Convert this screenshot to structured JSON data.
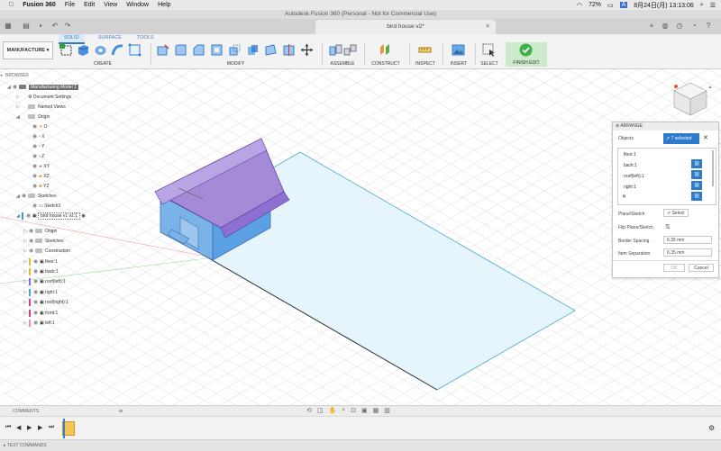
{
  "macbar": {
    "app": "Fusion 360",
    "menus": [
      "File",
      "Edit",
      "View",
      "Window",
      "Help"
    ],
    "battery": "72%",
    "datetime": "8月24日(月)  13:13:06"
  },
  "window": {
    "title": "Autodesk Fusion 360 (Personal - Not for Commercial Use)"
  },
  "document_tab": {
    "title": "bird house v2*"
  },
  "toolbar": {
    "workspace": "MANUFACTURE",
    "tabs": [
      "SOLID",
      "SURFACE",
      "TOOLS"
    ],
    "active_tab": "SOLID",
    "groups": [
      "CREATE",
      "MODIFY",
      "ASSEMBLE",
      "CONSTRUCT",
      "INSPECT",
      "INSERT",
      "SELECT",
      "FINISH EDIT"
    ]
  },
  "browser": {
    "header": "BROWSER",
    "rows": [
      {
        "label": "Manufacturing Model 1"
      },
      {
        "label": "Document Settings"
      },
      {
        "label": "Named Views"
      },
      {
        "label": "Origin"
      },
      {
        "label": "O"
      },
      {
        "label": "X"
      },
      {
        "label": "Y"
      },
      {
        "label": "Z"
      },
      {
        "label": "XY"
      },
      {
        "label": "XZ"
      },
      {
        "label": "YZ"
      },
      {
        "label": "Sketches"
      },
      {
        "label": "Sketch3"
      },
      {
        "label": "bird house v1 v2:1"
      },
      {
        "label": "Origin"
      },
      {
        "label": "Sketches"
      },
      {
        "label": "Construction"
      },
      {
        "label": "floor:1",
        "color": "#e5b733"
      },
      {
        "label": "back:1",
        "color": "#e5b733"
      },
      {
        "label": "roof(left):1",
        "color": "#8a6ad8"
      },
      {
        "label": "right:1",
        "color": "#33b0d9"
      },
      {
        "label": "roof(right):1",
        "color": "#d23f8f"
      },
      {
        "label": "front:1",
        "color": "#d23f8f"
      },
      {
        "label": "left:1",
        "color": "#e58fc0"
      }
    ]
  },
  "arrange": {
    "title": "ARRANGE",
    "objects_label": "Objects",
    "selected": "7 selected",
    "items": [
      "floor:1",
      "back:1",
      "roof(left):1",
      "right:1"
    ],
    "plane_label": "Plane/Sketch",
    "plane_button": "Select",
    "flip_label": "Flip Plane/Sketch",
    "border_label": "Border Spacing",
    "border_value": "6.35 mm",
    "separation_label": "Item Separation",
    "separation_value": "6.35 mm",
    "ok": "OK",
    "cancel": "Cancel"
  },
  "comments": {
    "label": "COMMENTS"
  },
  "text_commands": {
    "label": "TEXT COMMANDS"
  }
}
